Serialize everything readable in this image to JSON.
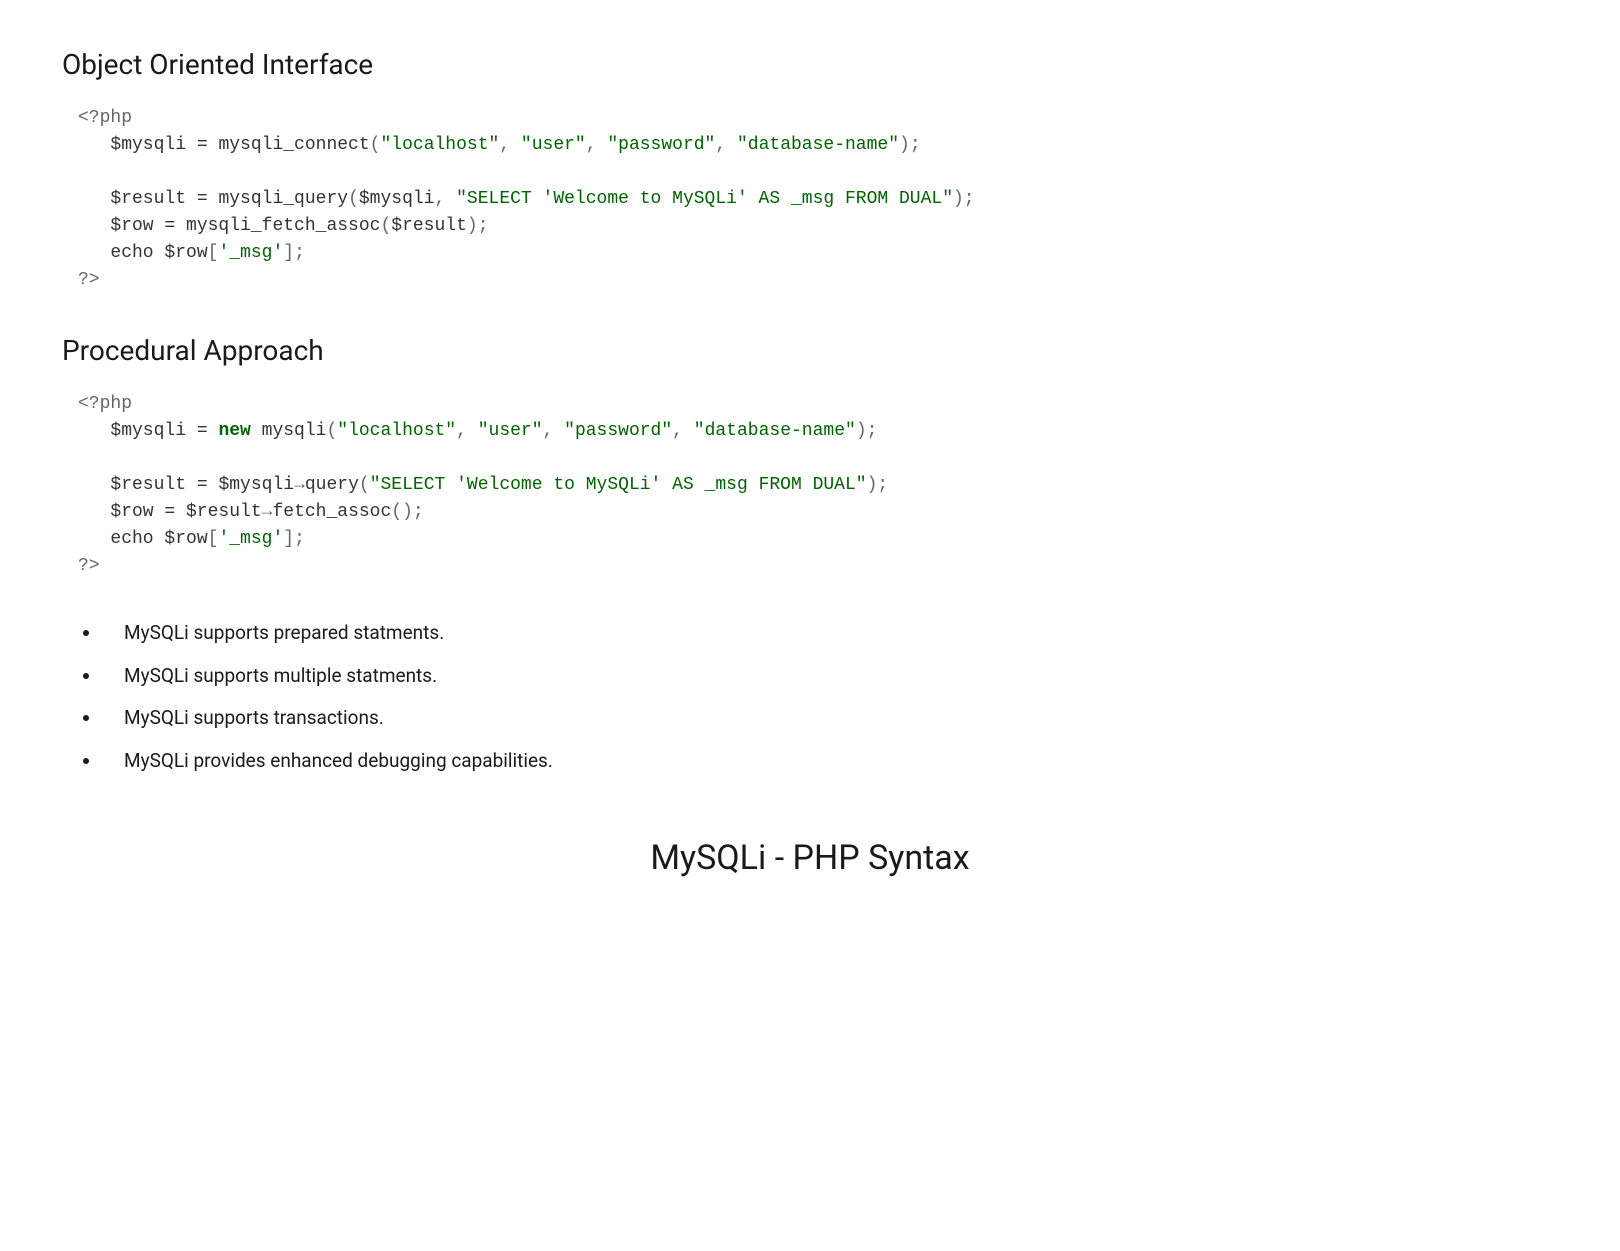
{
  "sections": {
    "oop": {
      "heading": "Object Oriented Interface",
      "code": {
        "open_tag": "<?php",
        "line1_var": "$mysqli",
        "line1_eq": " = ",
        "line1_func": "mysqli_connect",
        "line1_paren_open": "(",
        "line1_str1": "\"localhost\"",
        "line1_c1": ", ",
        "line1_str2": "\"user\"",
        "line1_c2": ", ",
        "line1_str3": "\"password\"",
        "line1_c3": ", ",
        "line1_str4": "\"database-name\"",
        "line1_paren_close": ");",
        "line2_var": "$result",
        "line2_eq": " = ",
        "line2_func": "mysqli_query",
        "line2_paren_open": "(",
        "line2_arg1": "$mysqli",
        "line2_c1": ", ",
        "line2_str": "\"SELECT 'Welcome to MySQLi' AS _msg FROM DUAL\"",
        "line2_paren_close": ");",
        "line3_var": "$row",
        "line3_eq": " = ",
        "line3_func": "mysqli_fetch_assoc",
        "line3_paren_open": "(",
        "line3_arg": "$result",
        "line3_paren_close": ");",
        "line4_echo": "echo ",
        "line4_var": "$row",
        "line4_br_open": "[",
        "line4_key": "'_msg'",
        "line4_br_close": "];",
        "close_tag": "?>"
      }
    },
    "procedural": {
      "heading": "Procedural Approach",
      "code": {
        "open_tag": "<?php",
        "line1_var": "$mysqli",
        "line1_eq": " = ",
        "line1_new": "new",
        "line1_sp": " ",
        "line1_class": "mysqli",
        "line1_paren_open": "(",
        "line1_str1": "\"localhost\"",
        "line1_c1": ", ",
        "line1_str2": "\"user\"",
        "line1_c2": ", ",
        "line1_str3": "\"password\"",
        "line1_c3": ", ",
        "line1_str4": "\"database-name\"",
        "line1_paren_close": ");",
        "line2_var": "$result",
        "line2_eq": " = ",
        "line2_obj": "$mysqli",
        "line2_arrow": "→",
        "line2_method": "query",
        "line2_paren_open": "(",
        "line2_str": "\"SELECT 'Welcome to MySQLi' AS _msg FROM DUAL\"",
        "line2_paren_close": ");",
        "line3_var": "$row",
        "line3_eq": " = ",
        "line3_obj": "$result",
        "line3_arrow": "→",
        "line3_method": "fetch_assoc",
        "line3_parens": "();",
        "line4_echo": "echo ",
        "line4_var": "$row",
        "line4_br_open": "[",
        "line4_key": "'_msg'",
        "line4_br_close": "];",
        "close_tag": "?>"
      }
    }
  },
  "bullets": [
    "MySQLi supports prepared statments.",
    "MySQLi supports multiple statments.",
    "MySQLi supports transactions.",
    "MySQLi provides enhanced debugging capabilities."
  ],
  "page_title": "MySQLi - PHP Syntax"
}
